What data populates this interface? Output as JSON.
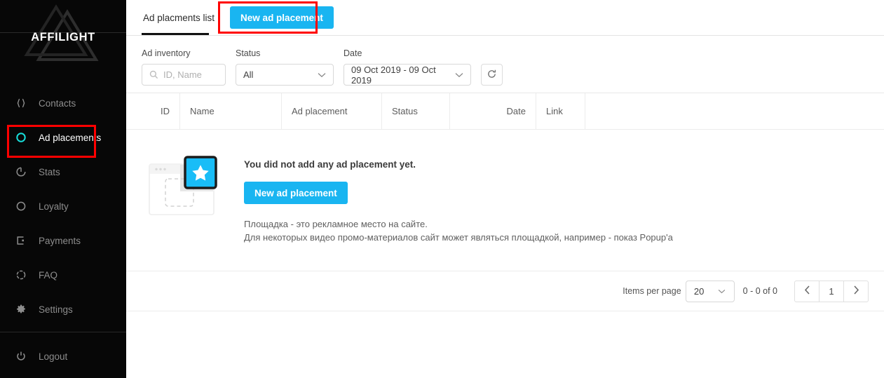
{
  "brand": {
    "name": "AFFILIGHT",
    "accent": "#17e0dc"
  },
  "colors": {
    "primary": "#19b5f1",
    "sidebar_bg": "#070707",
    "highlight": "#ff0000"
  },
  "sidebar": {
    "items": [
      {
        "label": "Contacts",
        "icon": "braces-icon",
        "active": false
      },
      {
        "label": "Ad placements",
        "icon": "circle-ring-icon",
        "active": true
      },
      {
        "label": "Stats",
        "icon": "progress-circle-icon",
        "active": false
      },
      {
        "label": "Loyalty",
        "icon": "circle-outline-icon",
        "active": false
      },
      {
        "label": "Payments",
        "icon": "card-icon",
        "active": false
      },
      {
        "label": "FAQ",
        "icon": "dashed-circle-icon",
        "active": false
      },
      {
        "label": "Settings",
        "icon": "gear-icon",
        "active": false
      }
    ],
    "logout": {
      "label": "Logout",
      "icon": "power-icon"
    }
  },
  "tabs": {
    "items": [
      {
        "label": "Ad placments list",
        "active": true
      }
    ],
    "new_button": "New ad placement"
  },
  "filters": {
    "inventory": {
      "label": "Ad inventory",
      "placeholder": "ID, Name",
      "value": "",
      "icon": "search-icon"
    },
    "status": {
      "label": "Status",
      "value": "All"
    },
    "date": {
      "label": "Date",
      "value": "09 Oct 2019 - 09 Oct 2019"
    },
    "reset": {
      "icon": "refresh-icon",
      "label": ""
    }
  },
  "table": {
    "columns": [
      "ID",
      "Name",
      "Ad placement",
      "Status",
      "Date",
      "Link"
    ],
    "rows": []
  },
  "empty_state": {
    "illustration": "ad-placement-star-illustration",
    "title": "You did not add any ad placement yet.",
    "button": "New ad placement",
    "hint_line_1": "Площадка - это рекламное место на сайте.",
    "hint_line_2": "Для некоторых видео промо-материалов сайт может являться площадкой, например - показ Popup'a"
  },
  "pagination": {
    "items_per_page_label": "Items per page",
    "items_per_page_value": "20",
    "range": "0 - 0 of 0",
    "page": "1",
    "prev_icon": "chevron-left-icon",
    "next_icon": "chevron-right-icon"
  }
}
